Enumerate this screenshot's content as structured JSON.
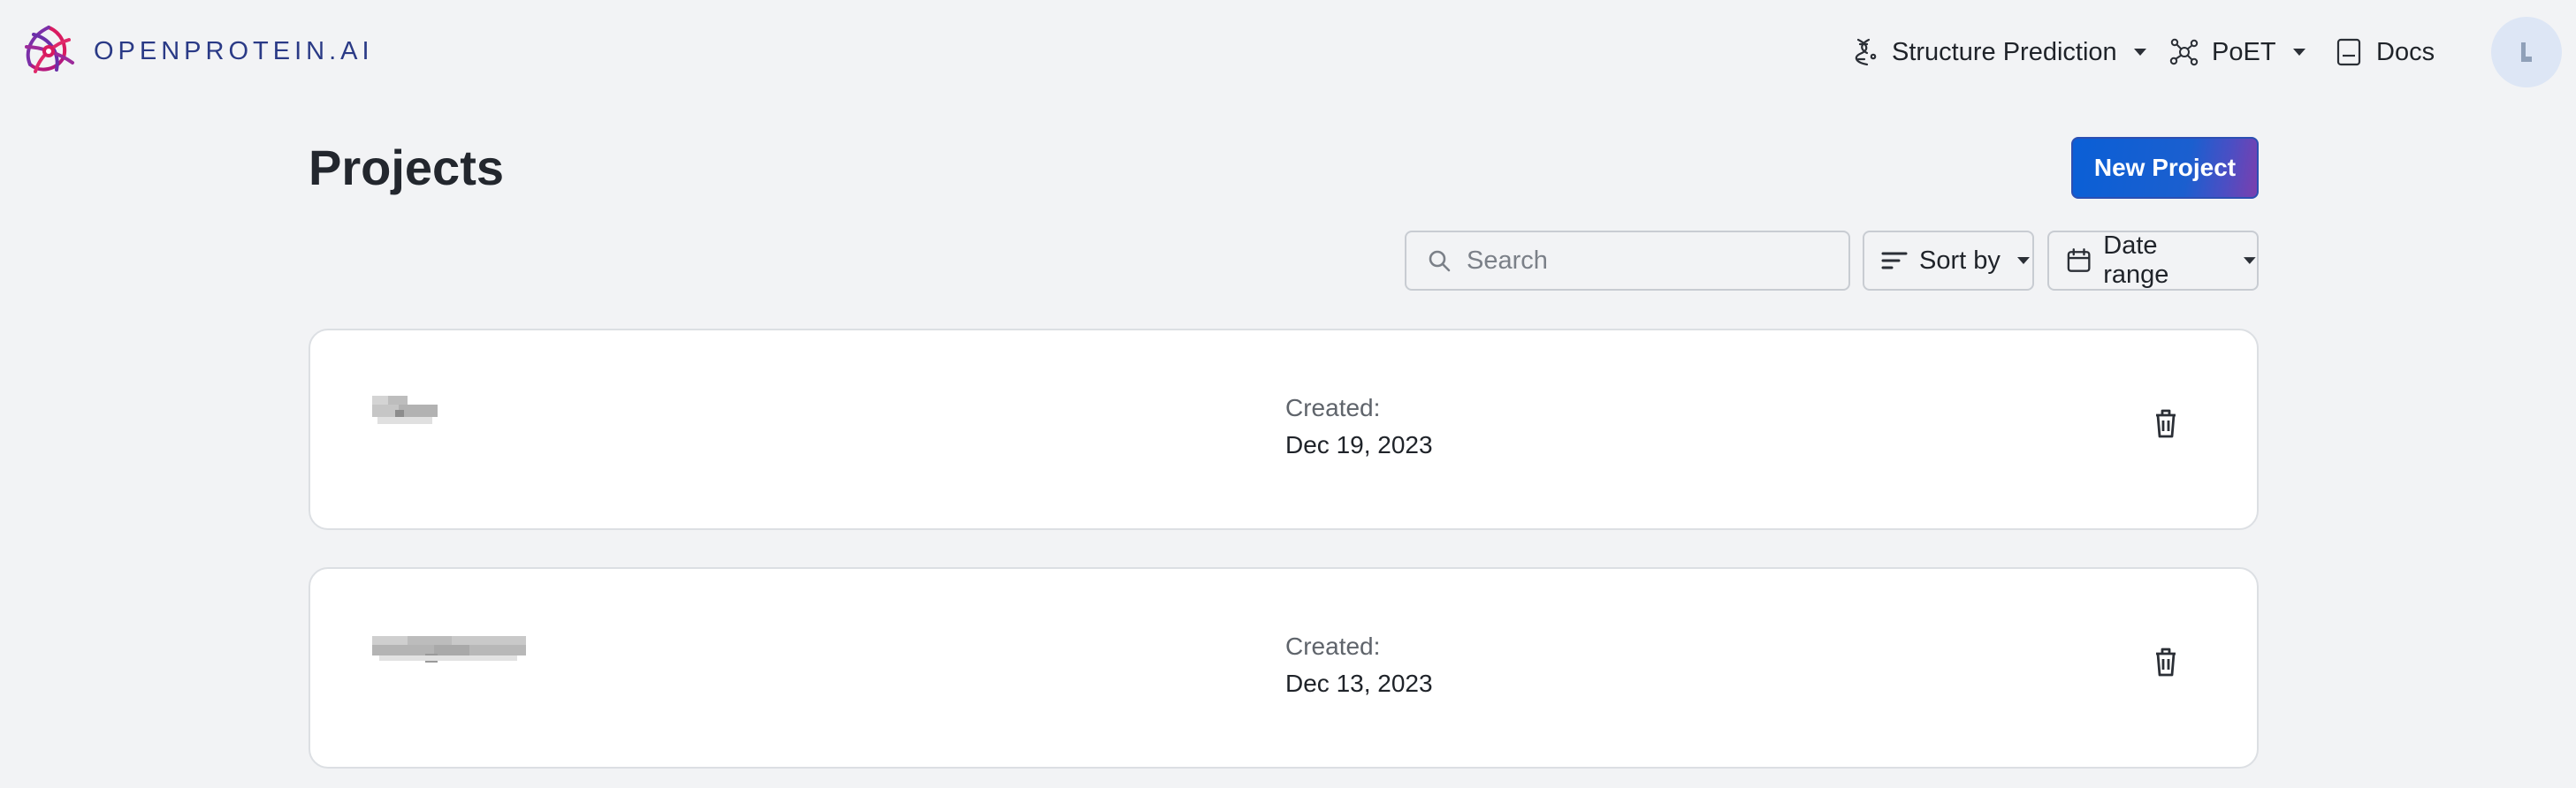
{
  "brand": {
    "name": "OPENPROTEIN.AI",
    "logo_icon": "openprotein-logo-icon"
  },
  "nav": {
    "structure_prediction": {
      "label": "Structure Prediction",
      "icon": "dna-structure-icon"
    },
    "poet": {
      "label": "PoET",
      "icon": "molecule-icon"
    },
    "docs": {
      "label": "Docs",
      "icon": "document-icon"
    }
  },
  "user": {
    "avatar_icon": "avatar-initial-icon"
  },
  "page": {
    "title": "Projects",
    "new_project_label": "New Project"
  },
  "toolbar": {
    "search_placeholder": "Search",
    "search_value": "",
    "sort_label": "Sort by",
    "date_range_label": "Date range"
  },
  "projects": [
    {
      "name_redacted": true,
      "created_label": "Created:",
      "created_date": "Dec 19, 2023"
    },
    {
      "name_redacted": true,
      "created_label": "Created:",
      "created_date": "Dec 13, 2023"
    }
  ],
  "colors": {
    "background": "#f2f3f5",
    "accent": "#0a5fd6",
    "accent_end": "#7b3fae",
    "brand_text": "#2a3a86",
    "logo_pink": "#d81b60",
    "logo_purple": "#6a2fa8"
  }
}
